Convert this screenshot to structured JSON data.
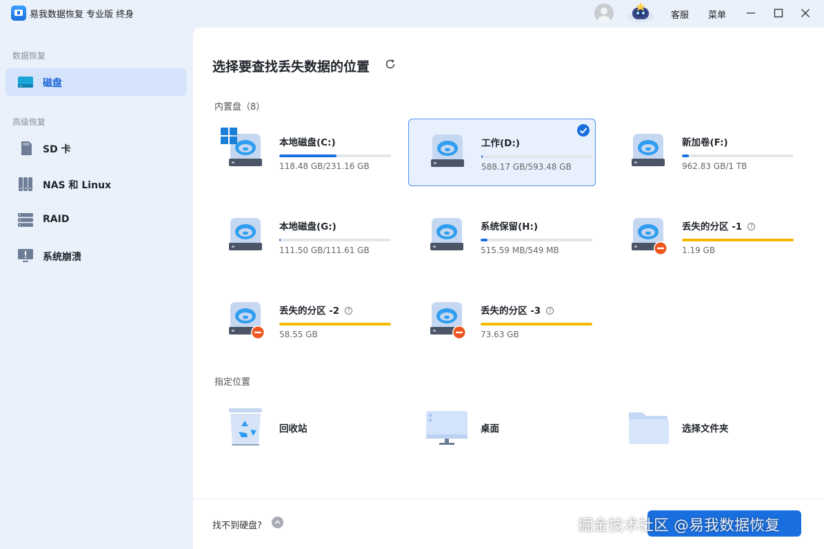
{
  "app": {
    "title": "易我数据恢复 专业版 终身",
    "service_label": "客服",
    "menu_label": "菜单"
  },
  "sidebar": {
    "section_recovery": "数据恢复",
    "section_advanced": "高级恢复",
    "items": [
      {
        "label": "磁盘",
        "icon": "disk-icon",
        "active": true
      },
      {
        "label": "SD 卡",
        "icon": "sd-card-icon",
        "active": false
      },
      {
        "label": "NAS 和 Linux",
        "icon": "nas-icon",
        "active": false
      },
      {
        "label": "RAID",
        "icon": "raid-icon",
        "active": false
      },
      {
        "label": "系统崩溃",
        "icon": "system-crash-icon",
        "active": false
      }
    ]
  },
  "main": {
    "title": "选择要查找丢失数据的位置",
    "internal_label": "内置盘",
    "internal_count": "（8）",
    "drives": [
      {
        "name": "本地磁盘(C:)",
        "size": "118.48 GB/231.16 GB",
        "usage": 0.51,
        "selected": false,
        "lost": false,
        "system": true
      },
      {
        "name": "工作(D:)",
        "size": "588.17 GB/593.48 GB",
        "usage": 0.01,
        "selected": true,
        "lost": false,
        "system": false
      },
      {
        "name": "新加卷(F:)",
        "size": "962.83 GB/1 TB",
        "usage": 0.06,
        "selected": false,
        "lost": false,
        "system": false
      },
      {
        "name": "本地磁盘(G:)",
        "size": "111.50 GB/111.61 GB",
        "usage": 0.01,
        "selected": false,
        "lost": false,
        "system": false
      },
      {
        "name": "系统保留(H:)",
        "size": "515.59 MB/549 MB",
        "usage": 0.06,
        "selected": false,
        "lost": false,
        "system": false
      },
      {
        "name": "丢失的分区 -1",
        "size": "1.19 GB",
        "usage": 1.0,
        "selected": false,
        "lost": true,
        "system": false
      },
      {
        "name": "丢失的分区 -2",
        "size": "58.55 GB",
        "usage": 1.0,
        "selected": false,
        "lost": true,
        "system": false
      },
      {
        "name": "丢失的分区 -3",
        "size": "73.63 GB",
        "usage": 1.0,
        "selected": false,
        "lost": true,
        "system": false
      }
    ],
    "location_label": "指定位置",
    "locations": [
      {
        "name": "回收站",
        "icon": "recycle-bin-icon"
      },
      {
        "name": "桌面",
        "icon": "desktop-icon"
      },
      {
        "name": "选择文件夹",
        "icon": "folder-icon"
      }
    ]
  },
  "footer": {
    "no_disk_text": "找不到硬盘?",
    "watermark": "掘金技术社区 @易我数据恢复"
  },
  "colors": {
    "accent": "#1a6fe0",
    "lost_bar": "#f5b900",
    "lost_badge": "#f0541e",
    "sidebar_bg": "#eaf1fb",
    "active_item_bg": "#d6e4fb"
  }
}
